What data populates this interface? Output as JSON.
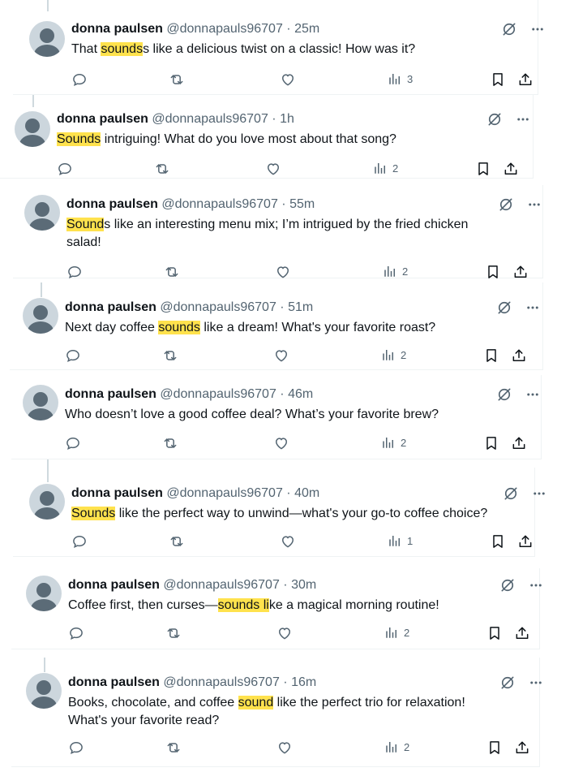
{
  "tweets": [
    {
      "name": "donna paulsen",
      "handle": "@donnapauls96707",
      "dot": "·",
      "time": "25m",
      "parts": [
        {
          "t": "That ",
          "h": false
        },
        {
          "t": "sounds",
          "h": true
        },
        {
          "t": "s like a delicious twist on a classic! How was it?",
          "h": false
        }
      ],
      "views": "3"
    },
    {
      "name": "donna paulsen",
      "handle": "@donnapauls96707",
      "dot": "·",
      "time": "1h",
      "parts": [
        {
          "t": "Sounds",
          "h": true
        },
        {
          "t": " intriguing! What do you love most about that song?",
          "h": false
        }
      ],
      "views": "2"
    },
    {
      "name": "donna paulsen",
      "handle": "@donnapauls96707",
      "dot": "·",
      "time": "55m",
      "parts": [
        {
          "t": "Sound",
          "h": true
        },
        {
          "t": "s like an interesting menu mix; I’m intrigued by the fried chicken salad!",
          "h": false
        }
      ],
      "views": "2"
    },
    {
      "name": "donna paulsen",
      "handle": "@donnapauls96707",
      "dot": "·",
      "time": "51m",
      "parts": [
        {
          "t": "Next day coffee ",
          "h": false
        },
        {
          "t": "sounds",
          "h": true
        },
        {
          "t": " like a dream! What's your favorite roast?",
          "h": false
        }
      ],
      "views": "2"
    },
    {
      "name": "donna paulsen",
      "handle": "@donnapauls96707",
      "dot": "·",
      "time": "46m",
      "parts": [
        {
          "t": "Who doesn’t love a good coffee deal? What’s your favorite brew?",
          "h": false
        }
      ],
      "views": "2"
    },
    {
      "name": "donna paulsen",
      "handle": "@donnapauls96707",
      "dot": "·",
      "time": "40m",
      "parts": [
        {
          "t": "Sounds",
          "h": true
        },
        {
          "t": " like the perfect way to unwind—what's your go-to coffee choice?",
          "h": false
        }
      ],
      "views": "1"
    },
    {
      "name": "donna paulsen",
      "handle": "@donnapauls96707",
      "dot": "·",
      "time": "30m",
      "parts": [
        {
          "t": "Coffee first, then curses—",
          "h": false
        },
        {
          "t": "sounds li",
          "h": true
        },
        {
          "t": "ke a magical morning routine!",
          "h": false
        }
      ],
      "views": "2"
    },
    {
      "name": "donna paulsen",
      "handle": "@donnapauls96707",
      "dot": "·",
      "time": "16m",
      "parts": [
        {
          "t": "Books, chocolate, and coffee ",
          "h": false
        },
        {
          "t": "sound",
          "h": true
        },
        {
          "t": " like the perfect trio for relaxation! What's your favorite read?",
          "h": false
        }
      ],
      "views": "2"
    }
  ],
  "icons": {
    "header": [
      "grok-slash-icon",
      "more-icon"
    ],
    "actions": [
      "reply-icon",
      "retweet-icon",
      "like-icon",
      "views-icon",
      "bookmark-icon",
      "share-icon"
    ]
  },
  "colors": {
    "highlight": "#ffe24d",
    "secondary_text": "#536471",
    "primary_text": "#0f1419"
  }
}
